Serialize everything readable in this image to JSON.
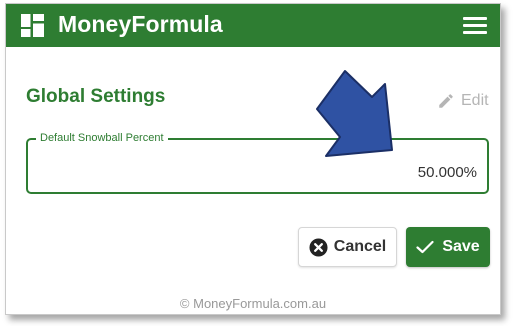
{
  "app": {
    "title": "MoneyFormula",
    "logo_icon": "dashboard-grid-icon",
    "menu_icon": "hamburger-menu-icon"
  },
  "colors": {
    "primary": "#2e7d32",
    "arrow": "#2f52a3",
    "muted": "#b5b5b5"
  },
  "page": {
    "title": "Global Settings",
    "edit_label": "Edit",
    "edit_icon": "pencil-icon"
  },
  "field": {
    "label": "Default Snowball Percent",
    "value": "50.000%"
  },
  "actions": {
    "cancel_label": "Cancel",
    "cancel_icon": "cancel-circle-icon",
    "save_label": "Save",
    "save_icon": "checkmark-icon"
  },
  "annotation": {
    "icon": "pointer-arrow-icon"
  },
  "footer": {
    "text": "© MoneyFormula.com.au"
  }
}
